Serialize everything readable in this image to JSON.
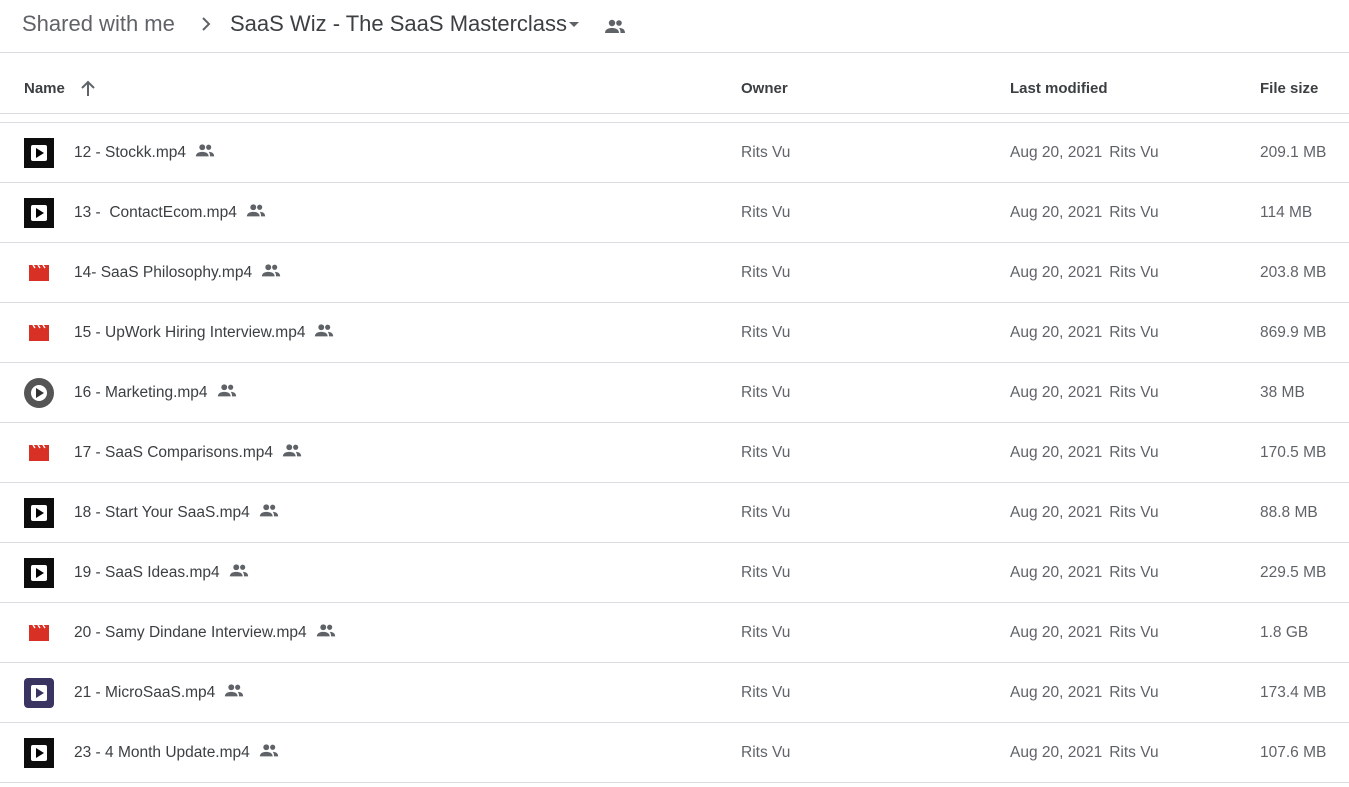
{
  "breadcrumb": {
    "root": "Shared with me",
    "current": "SaaS Wiz - The SaaS Masterclass"
  },
  "columns": {
    "name": "Name",
    "owner": "Owner",
    "last_modified": "Last modified",
    "file_size": "File size"
  },
  "files": [
    {
      "name": "12 - Stockk.mp4",
      "owner": "Rits Vu",
      "date": "Aug 20, 2021",
      "modified_by": "Rits Vu",
      "size": "209.1 MB",
      "icon": "video-thumbnail"
    },
    {
      "name": "13 -  ContactEcom.mp4",
      "owner": "Rits Vu",
      "date": "Aug 20, 2021",
      "modified_by": "Rits Vu",
      "size": "114 MB",
      "icon": "video-thumbnail"
    },
    {
      "name": "14- SaaS Philosophy.mp4",
      "owner": "Rits Vu",
      "date": "Aug 20, 2021",
      "modified_by": "Rits Vu",
      "size": "203.8 MB",
      "icon": "video-file-icon"
    },
    {
      "name": "15 - UpWork Hiring Interview.mp4",
      "owner": "Rits Vu",
      "date": "Aug 20, 2021",
      "modified_by": "Rits Vu",
      "size": "869.9 MB",
      "icon": "video-file-icon"
    },
    {
      "name": "16 - Marketing.mp4",
      "owner": "Rits Vu",
      "date": "Aug 20, 2021",
      "modified_by": "Rits Vu",
      "size": "38 MB",
      "icon": "video-thumbnail-round"
    },
    {
      "name": "17 - SaaS Comparisons.mp4",
      "owner": "Rits Vu",
      "date": "Aug 20, 2021",
      "modified_by": "Rits Vu",
      "size": "170.5 MB",
      "icon": "video-file-icon"
    },
    {
      "name": "18 - Start Your SaaS.mp4",
      "owner": "Rits Vu",
      "date": "Aug 20, 2021",
      "modified_by": "Rits Vu",
      "size": "88.8 MB",
      "icon": "video-thumbnail"
    },
    {
      "name": "19 - SaaS Ideas.mp4",
      "owner": "Rits Vu",
      "date": "Aug 20, 2021",
      "modified_by": "Rits Vu",
      "size": "229.5 MB",
      "icon": "video-thumbnail"
    },
    {
      "name": "20 - Samy Dindane Interview.mp4",
      "owner": "Rits Vu",
      "date": "Aug 20, 2021",
      "modified_by": "Rits Vu",
      "size": "1.8 GB",
      "icon": "video-file-icon"
    },
    {
      "name": "21 - MicroSaaS.mp4",
      "owner": "Rits Vu",
      "date": "Aug 20, 2021",
      "modified_by": "Rits Vu",
      "size": "173.4 MB",
      "icon": "video-thumbnail-purple"
    },
    {
      "name": "23 - 4 Month Update.mp4",
      "owner": "Rits Vu",
      "date": "Aug 20, 2021",
      "modified_by": "Rits Vu",
      "size": "107.6 MB",
      "icon": "video-thumbnail"
    }
  ],
  "colors": {
    "text": "#3c4043",
    "muted": "#5f6368",
    "divider": "#dadce0",
    "video_red": "#d93025"
  }
}
